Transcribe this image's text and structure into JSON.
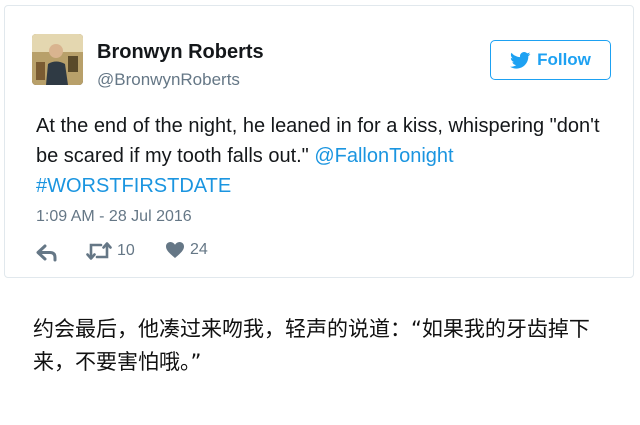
{
  "tweet": {
    "author": {
      "display_name": "Bronwyn Roberts",
      "screen_name": "@BronwynRoberts",
      "avatar_icon": "user-avatar-photo"
    },
    "follow_button": {
      "label": "Follow",
      "icon": "twitter-bird-icon"
    },
    "text": {
      "line_main": "At the end of the night, he leaned in for a kiss, whispering \"don't be scared if my tooth falls out.\" ",
      "mention": "@FallonTonight",
      "hashtag": "#WORSTFIRSTDATE"
    },
    "timestamp": "1:09 AM - 28 Jul 2016",
    "actions": {
      "reply": {
        "icon": "reply-icon"
      },
      "retweet": {
        "icon": "retweet-icon",
        "count": "10"
      },
      "like": {
        "icon": "heart-icon",
        "count": "24"
      }
    }
  },
  "caption": "约会最后，他凑过来吻我，轻声的说道：“如果我的牙齿掉下来，不要害怕哦。”",
  "colors": {
    "twitter_blue": "#1da1f2",
    "link_blue": "#1b95e0",
    "secondary_text": "#657786",
    "primary_text": "#14171a",
    "card_border": "#e1e8ed"
  }
}
